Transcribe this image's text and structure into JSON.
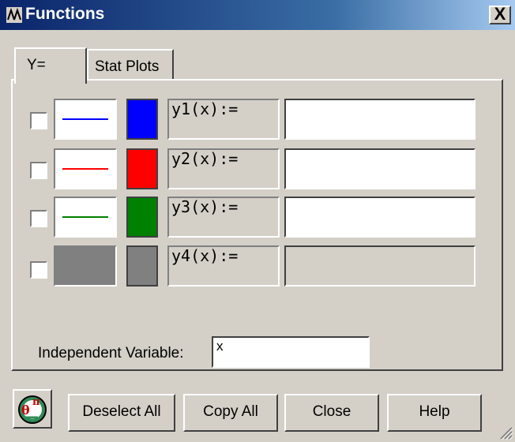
{
  "window": {
    "title": "Functions",
    "close_label": "X"
  },
  "tabs": [
    {
      "label": "Y=",
      "active": true
    },
    {
      "label": "Stat Plots",
      "active": false
    }
  ],
  "functions": [
    {
      "label": "y1(x):=",
      "value": "",
      "color": "#0000ff",
      "line_color": "#0000ff",
      "enabled": true
    },
    {
      "label": "y2(x):=",
      "value": "",
      "color": "#ff0000",
      "line_color": "#ff0000",
      "enabled": true
    },
    {
      "label": "y3(x):=",
      "value": "",
      "color": "#008000",
      "line_color": "#008000",
      "enabled": true
    },
    {
      "label": "y4(x):=",
      "value": "",
      "color": "#808080",
      "line_color": "#808080",
      "enabled": false
    }
  ],
  "independent": {
    "label": "Independent Variable:",
    "value": "x"
  },
  "buttons": {
    "deselect_all": "Deselect All",
    "copy_all": "Copy All",
    "close": "Close",
    "help": "Help"
  },
  "icons": {
    "app": "functions-app-icon",
    "logo": "theta-pi-logo-icon"
  }
}
